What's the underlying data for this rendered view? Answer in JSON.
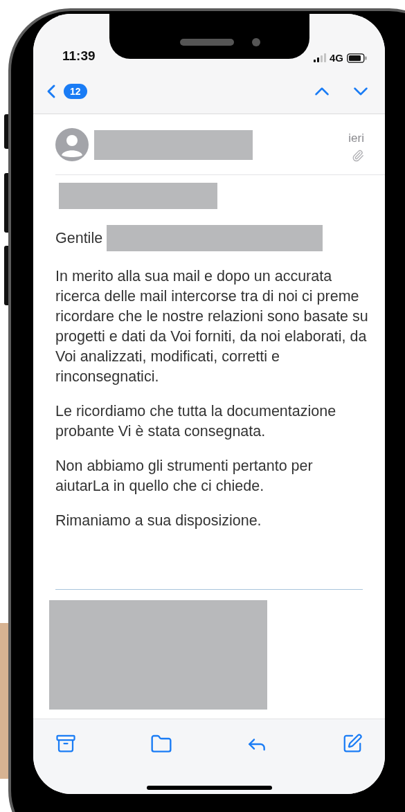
{
  "status_bar": {
    "time": "11:39",
    "network": "4G"
  },
  "nav_bar": {
    "unread_count": "12"
  },
  "message": {
    "sender": {
      "redacted": true
    },
    "date": "ieri",
    "has_attachment": true,
    "subject": {
      "redacted": true
    },
    "greeting": {
      "text": "Gentile",
      "redacted": true
    },
    "paragraphs": [
      "In merito alla sua mail e dopo un accurata ricerca delle mail intercorse tra di noi ci preme ricordare che le nostre relazioni sono basate su progetti e dati da Voi forniti, da noi elaborati, da Voi analizzati, modificati, corretti e rinconsegnatici.",
      "Le ricordiamo che tutta la documentazione probante Vi è stata consegnata.",
      "Non abbiamo gli strumenti pertanto per aiutarLa in quello che ci chiede.",
      "Rimaniamo a sua disposizione."
    ],
    "signature": {
      "redacted": true
    }
  },
  "toolbar": [
    {
      "kind": "archive"
    },
    {
      "kind": "folder"
    },
    {
      "kind": "reply"
    },
    {
      "kind": "compose"
    }
  ]
}
